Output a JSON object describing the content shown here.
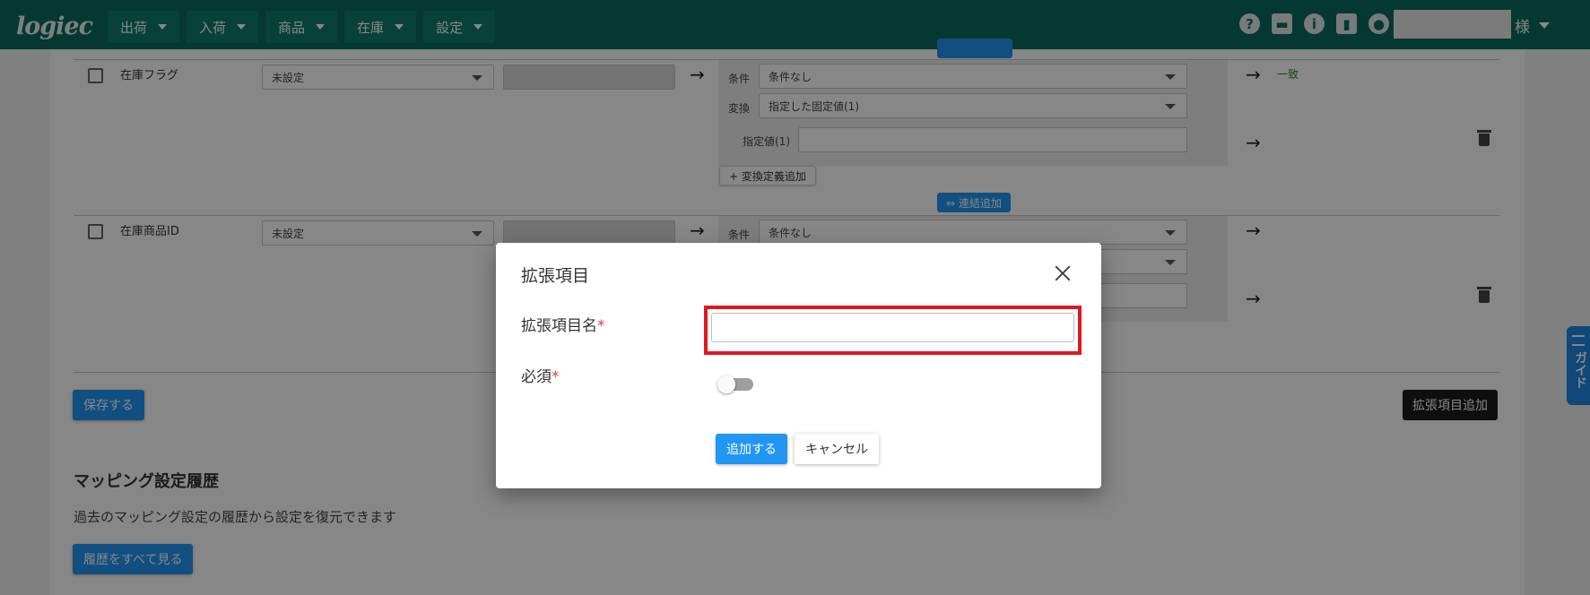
{
  "header": {
    "logo": "logiec",
    "nav": [
      {
        "label": "出荷"
      },
      {
        "label": "入荷"
      },
      {
        "label": "商品"
      },
      {
        "label": "在庫"
      },
      {
        "label": "設定"
      }
    ],
    "icons": [
      "help-icon",
      "briefcase-icon",
      "info-icon",
      "chart-icon",
      "account-icon"
    ],
    "user_suffix": "様"
  },
  "rows": [
    {
      "label": "在庫フラグ",
      "select": "未設定",
      "condition_label": "条件",
      "condition_value": "条件なし",
      "convert_label": "変換",
      "convert_value": "指定した固定値(1)",
      "fixed_label": "指定値(1)",
      "result": "一致",
      "add_convert": "+ 変換定義追加",
      "add_link": "⇔ 連結追加"
    },
    {
      "label": "在庫商品ID",
      "select": "未設定",
      "condition_label": "条件",
      "condition_value": "条件なし"
    }
  ],
  "actions": {
    "save": "保存する",
    "add_extension": "拡張項目追加"
  },
  "history": {
    "title": "マッピング設定履歴",
    "description": "過去のマッピング設定の履歴から設定を復元できます",
    "view_all": "履歴をすべて見る"
  },
  "modal": {
    "title": "拡張項目",
    "name_label": "拡張項目名",
    "required_label": "必須",
    "required_mark": "*",
    "name_value": "",
    "add_button": "追加する",
    "cancel_button": "キャンセル"
  },
  "guide": {
    "label": "ガイド"
  },
  "colors": {
    "header": "#0b6b5d",
    "primary": "#2196f3",
    "highlight": "#e1171e",
    "required": "#e53935"
  }
}
